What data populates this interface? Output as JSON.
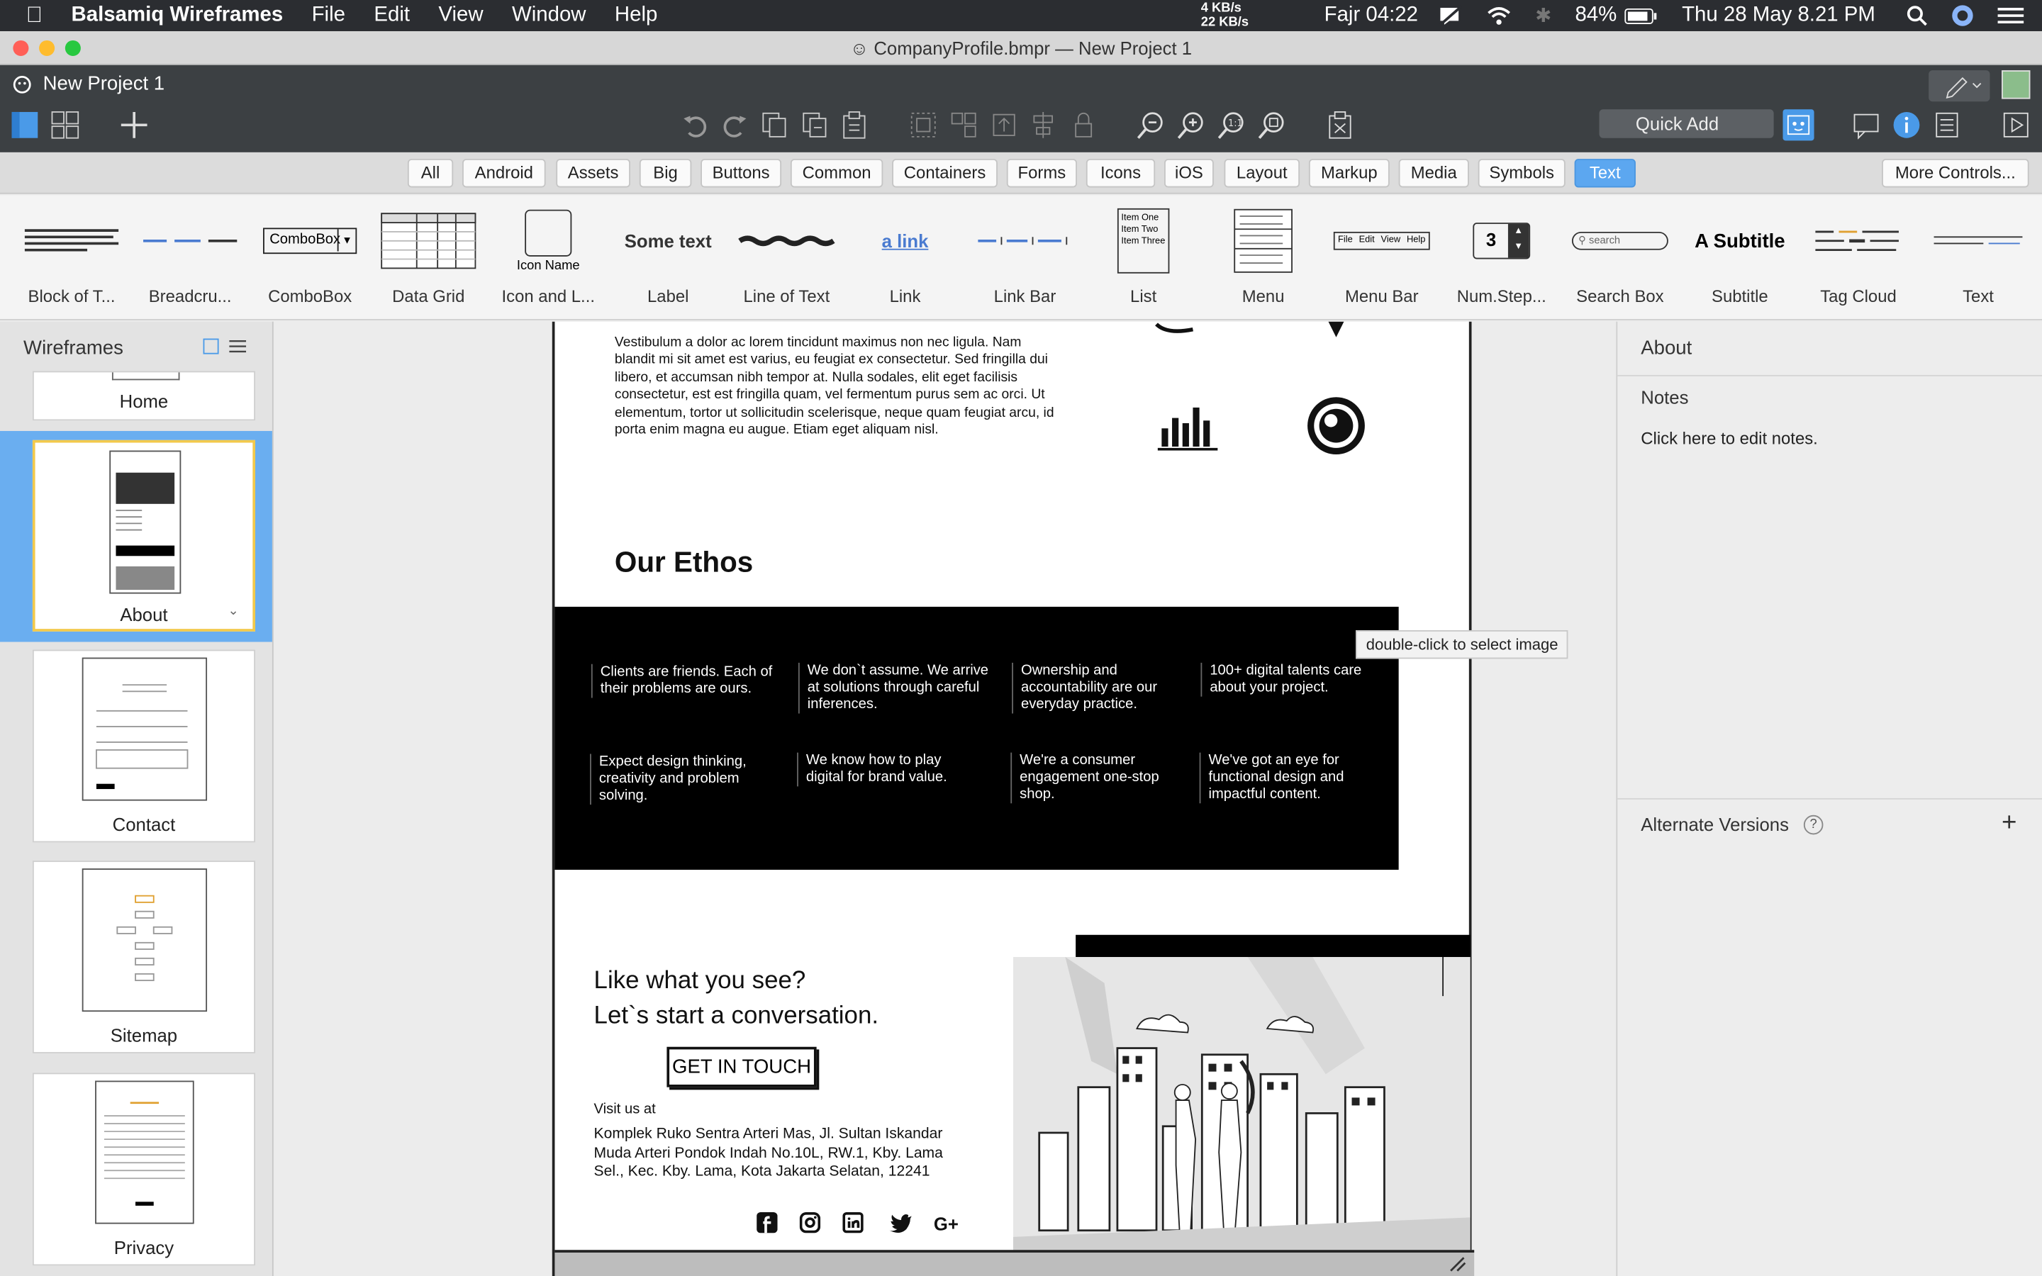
{
  "menubar": {
    "app_name": "Balsamiq Wireframes",
    "items": [
      "File",
      "Edit",
      "View",
      "Window",
      "Help"
    ],
    "net_up": "4 KB/s",
    "net_down": "22 KB/s",
    "prayer": "Fajr 04:22",
    "battery": "84%",
    "datetime": "Thu 28 May  8.21 PM"
  },
  "window": {
    "title": "CompanyProfile.bmpr — New Project 1",
    "project_name": "New Project 1"
  },
  "toolbar": {
    "quick_add_placeholder": "Quick Add"
  },
  "filters": {
    "chips": [
      "All",
      "Android",
      "Assets",
      "Big",
      "Buttons",
      "Common",
      "Containers",
      "Forms",
      "Icons",
      "iOS",
      "Layout",
      "Markup",
      "Media",
      "Symbols",
      "Text"
    ],
    "selected": "Text",
    "more_controls": "More Controls..."
  },
  "library": {
    "items": [
      {
        "label": "Block of T..."
      },
      {
        "label": "Breadcru..."
      },
      {
        "label": "ComboBox",
        "preview_text": "ComboBox"
      },
      {
        "label": "Data Grid"
      },
      {
        "label": "Icon and L...",
        "preview_text": "Icon Name"
      },
      {
        "label": "Label",
        "preview_text": "Some text"
      },
      {
        "label": "Line of Text"
      },
      {
        "label": "Link",
        "preview_text": "a link"
      },
      {
        "label": "Link Bar"
      },
      {
        "label": "List",
        "preview_lines": [
          "Item One",
          "Item Two",
          "Item Three"
        ]
      },
      {
        "label": "Menu"
      },
      {
        "label": "Menu Bar",
        "preview_items": [
          "File",
          "Edit",
          "View",
          "Help"
        ]
      },
      {
        "label": "Num.Step...",
        "preview_text": "3"
      },
      {
        "label": "Search Box",
        "preview_text": "search"
      },
      {
        "label": "Subtitle",
        "preview_text": "A Subtitle"
      },
      {
        "label": "Tag Cloud"
      },
      {
        "label": "Text"
      }
    ]
  },
  "sidebar": {
    "title": "Wireframes",
    "pages": [
      {
        "label": "Home"
      },
      {
        "label": "About",
        "selected": true
      },
      {
        "label": "Contact"
      },
      {
        "label": "Sitemap"
      },
      {
        "label": "Privacy"
      }
    ]
  },
  "wireframe": {
    "intro_paragraph": "Vestibulum a dolor ac lorem tincidunt maximus non nec ligula. Nam blandit mi sit amet est varius, eu feugiat ex consectetur. Sed fringilla dui libero, et accumsan nibh tempor at. Nulla sodales, elit eget facilisis consectetur, est est fringilla quam, vel fermentum purus sem ac orci. Ut elementum, tortor ut sollicitudin scelerisque, neque quam feugiat arcu, id porta enim magna eu augue. Etiam eget aliquam nisl.",
    "ethos_heading": "Our Ethos",
    "ethos_items": [
      "Clients are friends. Each of their problems are ours.",
      "We don`t assume. We arrive at solutions through careful inferences.",
      "Ownership and accountability are our everyday practice.",
      "100+ digital talents care about your project.",
      "Expect design thinking, creativity and problem solving.",
      "We know how to play digital for brand value.",
      "We're a consumer engagement one-stop shop.",
      "We've got an eye for functional design and impactful content."
    ],
    "tooltip": "double-click to select image",
    "cta_line1": "Like what you see?",
    "cta_line2": "Let`s start a conversation.",
    "cta_button": "GET IN TOUCH",
    "visit_label": "Visit us at",
    "address": "Komplek Ruko Sentra Arteri Mas, Jl. Sultan Iskandar Muda Arteri Pondok Indah No.10L, RW.1, Kby. Lama Sel., Kec. Kby. Lama, Kota Jakarta Selatan, 12241",
    "social": [
      "facebook",
      "instagram",
      "linkedin",
      "twitter",
      "google-plus"
    ]
  },
  "right_panel": {
    "title": "About",
    "notes_label": "Notes",
    "notes_placeholder": "Click here to edit notes.",
    "alt_versions_label": "Alternate Versions"
  },
  "colors": {
    "accent": "#5ca7f0",
    "selected_page_bg": "#6aaef0",
    "selected_thumb_border": "#f2c94c",
    "toolbar_bg": "#3c4043"
  }
}
